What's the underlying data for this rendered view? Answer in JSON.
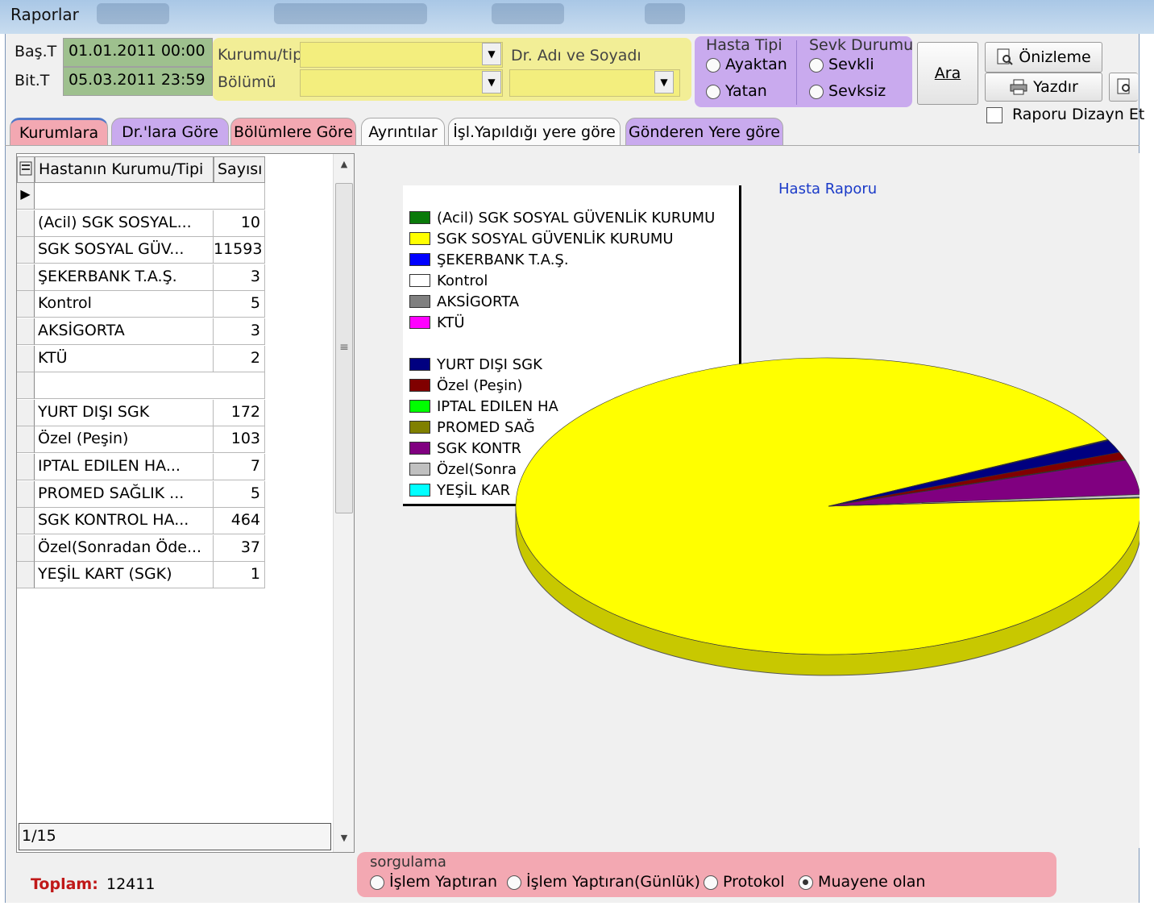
{
  "window": {
    "title": "Raporlar"
  },
  "filters": {
    "bas_label": "Baş.T",
    "bit_label": "Bit.T",
    "bas_value": "01.01.2011 00:00",
    "bit_value": "05.03.2011 23:59",
    "kurum_label": "Kurumu/tipi",
    "bolum_label": "Bölümü",
    "dr_label": "Dr. Adı ve Soyadı",
    "hasta_tipi": {
      "title": "Hasta Tipi",
      "options": [
        "Ayaktan",
        "Yatan"
      ]
    },
    "sevk_durumu": {
      "title": "Sevk Durumu",
      "options": [
        "Sevkli",
        "Sevksiz"
      ]
    }
  },
  "buttons": {
    "ara": "Ara",
    "onizleme": "Önizleme",
    "yazdir": "Yazdır",
    "dizayn": "Raporu Dizayn Et"
  },
  "tabs": [
    "Kurumlara",
    "Dr.'lara Göre",
    "Bölümlere Göre",
    "Ayrıntılar",
    "İşl.Yapıldığı yere göre",
    "Gönderen Yere göre"
  ],
  "grid": {
    "headers": [
      "Hastanın Kurumu/Tipi",
      "Sayısı"
    ],
    "rows": [
      {
        "name": "",
        "value": ""
      },
      {
        "name": "(Acil) SGK SOSYAL...",
        "value": "10"
      },
      {
        "name": "SGK SOSYAL GÜV...",
        "value": "11593"
      },
      {
        "name": "ŞEKERBANK T.A.Ş.",
        "value": "3"
      },
      {
        "name": "Kontrol",
        "value": "5"
      },
      {
        "name": "AKSİGORTA",
        "value": "3"
      },
      {
        "name": "KTÜ",
        "value": "2"
      },
      {
        "name": "",
        "value": ""
      },
      {
        "name": "YURT DIŞI SGK",
        "value": "172"
      },
      {
        "name": "Özel (Peşin)",
        "value": "103"
      },
      {
        "name": "IPTAL EDILEN HA...",
        "value": "7"
      },
      {
        "name": "PROMED SAĞLIK ...",
        "value": "5"
      },
      {
        "name": "SGK KONTROL HA...",
        "value": "464"
      },
      {
        "name": "Özel(Sonradan Öde...",
        "value": "37"
      },
      {
        "name": "YEŞİL KART (SGK)",
        "value": "1"
      }
    ],
    "pager": "1/15"
  },
  "total": {
    "label": "Toplam:",
    "value": "12411"
  },
  "chart": {
    "title": "Hasta Raporu"
  },
  "legend": [
    {
      "label": "(Acil) SGK SOSYAL GÜVENLİK KURUMU",
      "color": "#0a7a0a"
    },
    {
      "label": "SGK SOSYAL GÜVENLİK KURUMU",
      "color": "#ffff00"
    },
    {
      "label": "ŞEKERBANK T.A.Ş.",
      "color": "#0000ff"
    },
    {
      "label": "Kontrol",
      "color": "#ffffff"
    },
    {
      "label": "AKSİGORTA",
      "color": "#808080"
    },
    {
      "label": "KTÜ",
      "color": "#ff00ff"
    },
    {
      "label": "",
      "color": ""
    },
    {
      "label": "YURT DIŞI SGK",
      "color": "#000080"
    },
    {
      "label": "Özel (Peşin)",
      "color": "#800000"
    },
    {
      "label": "IPTAL EDILEN HA",
      "color": "#00ff00"
    },
    {
      "label": "PROMED SAĞ",
      "color": "#808000"
    },
    {
      "label": "SGK KONTR",
      "color": "#800080"
    },
    {
      "label": "Özel(Sonra",
      "color": "#c0c0c0"
    },
    {
      "label": "YEŞİL KAR",
      "color": "#00ffff"
    }
  ],
  "chart_data": {
    "type": "pie",
    "title": "Hasta Raporu",
    "categories": [
      "(Acil) SGK SOSYAL GÜVENLİK KURUMU",
      "SGK SOSYAL GÜVENLİK KURUMU",
      "ŞEKERBANK T.A.Ş.",
      "Kontrol",
      "AKSİGORTA",
      "KTÜ",
      "",
      "YURT DIŞI SGK",
      "Özel (Peşin)",
      "IPTAL EDILEN HASTA",
      "PROMED SAĞLIK",
      "SGK KONTROL HASTA",
      "Özel(Sonradan Ödeme)",
      "YEŞİL KART (SGK)"
    ],
    "values": [
      10,
      11593,
      3,
      5,
      3,
      2,
      0,
      172,
      103,
      7,
      5,
      464,
      37,
      1
    ],
    "colors": [
      "#0a7a0a",
      "#ffff00",
      "#0000ff",
      "#ffffff",
      "#808080",
      "#ff00ff",
      "#000000",
      "#000080",
      "#800000",
      "#00ff00",
      "#808000",
      "#800080",
      "#c0c0c0",
      "#00ffff"
    ],
    "legend": "left"
  },
  "sorgulama": {
    "title": "sorgulama",
    "options": [
      "İşlem Yaptıran",
      "İşlem Yaptıran(Günlük)",
      "Protokol",
      "Muayene olan"
    ],
    "selected": "Muayene olan"
  }
}
